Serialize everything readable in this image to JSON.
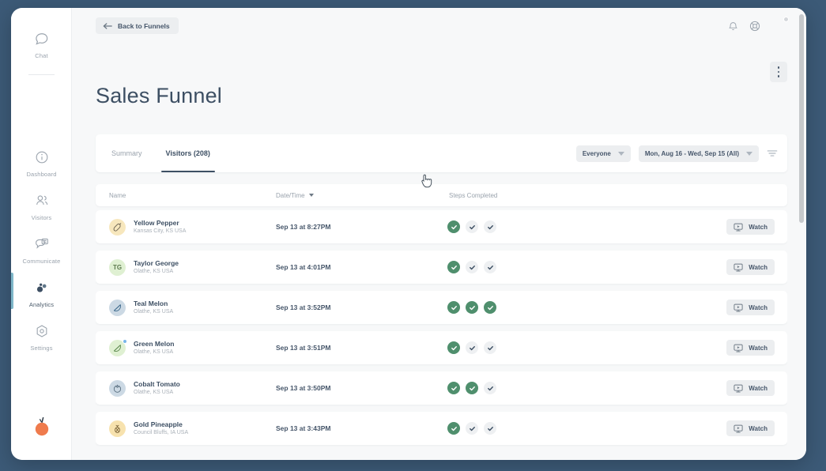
{
  "theme": {
    "desktop_bg": "#3c5a77",
    "window_bg": "#f7f8f9",
    "accent_green": "#4f8f6d",
    "accent_blue": "#7fb7c9",
    "text_dark": "#3d4f63",
    "text_muted": "#9aa3ad"
  },
  "sidebar": {
    "chat": {
      "label": "Chat",
      "icon": "chat-bubble-icon"
    },
    "items": [
      {
        "label": "Dashboard",
        "icon": "dashboard-info-icon",
        "active": false
      },
      {
        "label": "Visitors",
        "icon": "visitors-people-icon",
        "active": false
      },
      {
        "label": "Communicate",
        "icon": "communicate-message-icon",
        "active": false
      },
      {
        "label": "Analytics",
        "icon": "analytics-dots-icon",
        "active": true
      },
      {
        "label": "Settings",
        "icon": "settings-hexagon-icon",
        "active": false
      }
    ],
    "logo": {
      "name": "orange-fruit-logo",
      "color": "#ef7b4d"
    }
  },
  "topbar": {
    "back_label": "Back to Funnels",
    "back_icon": "arrow-left-icon",
    "notifications_icon": "bell-icon",
    "help_icon": "globe-help-icon",
    "avatar_name": "user-avatar",
    "kebab_icon": "more-vertical-icon"
  },
  "page": {
    "title": "Sales Funnel"
  },
  "tabs": [
    {
      "label": "Summary",
      "active": false
    },
    {
      "label": "Visitors (208)",
      "active": true
    }
  ],
  "filters": {
    "audience": {
      "value": "Everyone"
    },
    "date_range": {
      "value": "Mon, Aug 16 - Wed, Sep 15 (All)"
    },
    "filter_icon": "filter-lines-icon"
  },
  "table": {
    "columns": [
      {
        "key": "name",
        "label": "Name",
        "sorted": false
      },
      {
        "key": "date",
        "label": "Date/Time",
        "sorted": true
      },
      {
        "key": "steps",
        "label": "Steps Completed",
        "sorted": false
      }
    ],
    "watch_label": "Watch",
    "watch_icon": "monitor-play-icon",
    "rows": [
      {
        "name": "Yellow Pepper",
        "location": "Kansas City, KS USA",
        "date": "Sep 13 at 8:27PM",
        "avatar": {
          "type": "icon",
          "glyph": "pepper-icon",
          "bg": "#f7e7bd",
          "fg": "#6b6250",
          "dot": false
        },
        "steps": [
          true,
          false,
          false
        ]
      },
      {
        "name": "Taylor George",
        "location": "Olathe, KS USA",
        "date": "Sep 13 at 4:01PM",
        "avatar": {
          "type": "initials",
          "glyph": "TG",
          "bg": "#dff0d2",
          "fg": "#5d7a4f",
          "dot": false
        },
        "steps": [
          true,
          false,
          false
        ]
      },
      {
        "name": "Teal Melon",
        "location": "Olathe, KS USA",
        "date": "Sep 13 at 3:52PM",
        "avatar": {
          "type": "icon",
          "glyph": "melon-icon",
          "bg": "#ccd9e4",
          "fg": "#3d6a8c",
          "dot": false
        },
        "steps": [
          true,
          true,
          true
        ]
      },
      {
        "name": "Green Melon",
        "location": "Olathe, KS USA",
        "date": "Sep 13 at 3:51PM",
        "avatar": {
          "type": "icon",
          "glyph": "melon-icon",
          "bg": "#dff0d2",
          "fg": "#5d8a4f",
          "dot": true
        },
        "steps": [
          true,
          false,
          false
        ]
      },
      {
        "name": "Cobalt Tomato",
        "location": "Olathe, KS USA",
        "date": "Sep 13 at 3:50PM",
        "avatar": {
          "type": "icon",
          "glyph": "tomato-icon",
          "bg": "#ccd9e4",
          "fg": "#566c7d",
          "dot": false
        },
        "steps": [
          true,
          true,
          false
        ]
      },
      {
        "name": "Gold Pineapple",
        "location": "Council Bluffs, IA USA",
        "date": "Sep 13 at 3:43PM",
        "avatar": {
          "type": "icon",
          "glyph": "pineapple-icon",
          "bg": "#f7e2ae",
          "fg": "#7a6338",
          "dot": false
        },
        "steps": [
          true,
          false,
          false
        ]
      }
    ]
  }
}
